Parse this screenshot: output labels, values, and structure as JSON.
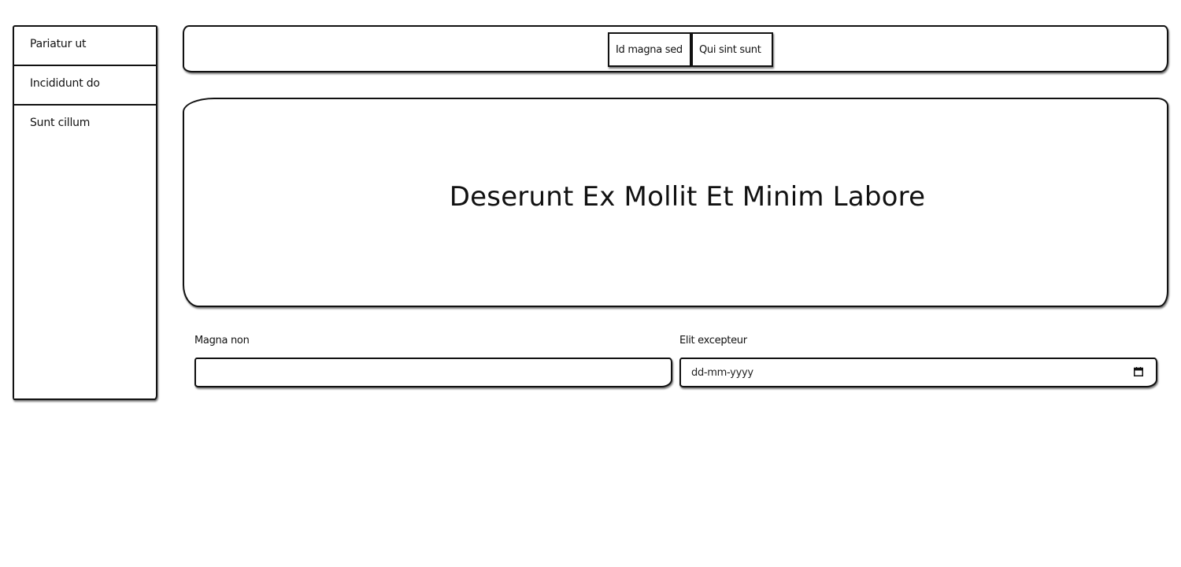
{
  "sidebar": {
    "items": [
      {
        "label": "Pariatur ut"
      },
      {
        "label": "Incididunt do"
      },
      {
        "label": "Sunt cillum"
      }
    ]
  },
  "topbar": {
    "buttons": [
      {
        "label": "Id magna sed"
      },
      {
        "label": "Qui sint sunt"
      }
    ]
  },
  "hero": {
    "title": "Deserunt Ex Mollit Et Minim Labore"
  },
  "form": {
    "field_1": {
      "label": "Magna non",
      "value": ""
    },
    "field_2": {
      "label": "Elit excepteur",
      "placeholder": "dd-mm-yyyy",
      "icon": "calendar-icon"
    }
  }
}
